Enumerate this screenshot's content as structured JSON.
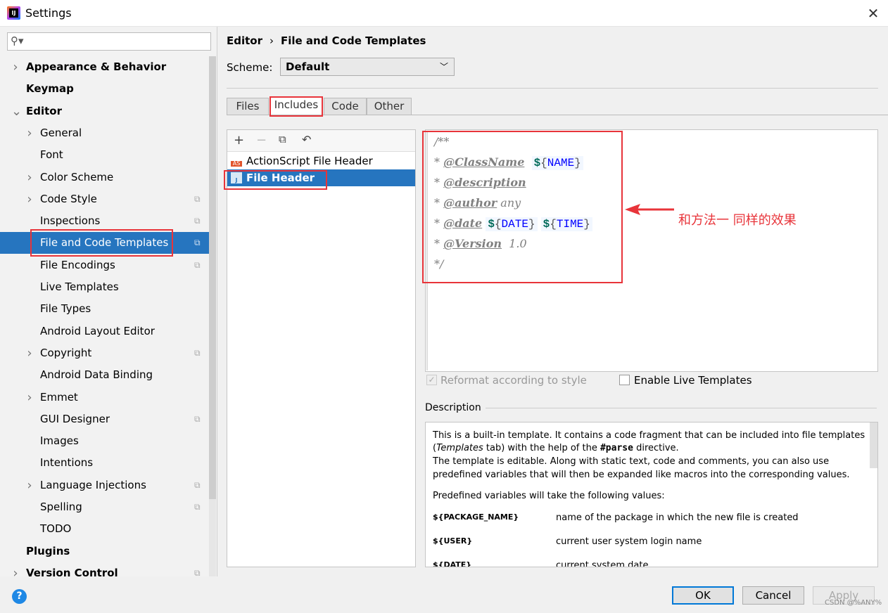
{
  "window": {
    "title": "Settings",
    "app_icon": "intellij-idea-icon"
  },
  "search": {
    "placeholder": ""
  },
  "sidebar": {
    "items": [
      {
        "label": "Appearance & Behavior",
        "level": 0,
        "expandable": true,
        "bold": true
      },
      {
        "label": "Keymap",
        "level": 0,
        "bold": true
      },
      {
        "label": "Editor",
        "level": 0,
        "expandable": true,
        "expanded": true,
        "bold": true
      },
      {
        "label": "General",
        "level": 1,
        "expandable": true
      },
      {
        "label": "Font",
        "level": 1
      },
      {
        "label": "Color Scheme",
        "level": 1,
        "expandable": true
      },
      {
        "label": "Code Style",
        "level": 1,
        "expandable": true,
        "copy": true
      },
      {
        "label": "Inspections",
        "level": 1,
        "copy": true
      },
      {
        "label": "File and Code Templates",
        "level": 1,
        "copy": true,
        "selected": true
      },
      {
        "label": "File Encodings",
        "level": 1,
        "copy": true
      },
      {
        "label": "Live Templates",
        "level": 1
      },
      {
        "label": "File Types",
        "level": 1
      },
      {
        "label": "Android Layout Editor",
        "level": 1
      },
      {
        "label": "Copyright",
        "level": 1,
        "expandable": true,
        "copy": true
      },
      {
        "label": "Android Data Binding",
        "level": 1
      },
      {
        "label": "Emmet",
        "level": 1,
        "expandable": true
      },
      {
        "label": "GUI Designer",
        "level": 1,
        "copy": true
      },
      {
        "label": "Images",
        "level": 1
      },
      {
        "label": "Intentions",
        "level": 1
      },
      {
        "label": "Language Injections",
        "level": 1,
        "expandable": true,
        "copy": true
      },
      {
        "label": "Spelling",
        "level": 1,
        "copy": true
      },
      {
        "label": "TODO",
        "level": 1
      },
      {
        "label": "Plugins",
        "level": 0,
        "bold": true
      },
      {
        "label": "Version Control",
        "level": 0,
        "expandable": true,
        "bold": true,
        "copy": true
      }
    ]
  },
  "breadcrumb": {
    "part1": "Editor",
    "separator": "›",
    "part2": "File and Code Templates"
  },
  "scheme": {
    "label": "Scheme:",
    "value": "Default"
  },
  "tabs": [
    {
      "label": "Files"
    },
    {
      "label": "Includes",
      "active": true
    },
    {
      "label": "Code"
    },
    {
      "label": "Other"
    }
  ],
  "template_list": [
    {
      "label": "ActionScript File Header",
      "icon": "AS"
    },
    {
      "label": "File Header",
      "icon": "J",
      "selected": true
    }
  ],
  "editor": {
    "lines": [
      {
        "star": "/**"
      },
      {
        "star": "* ",
        "tag": "@ClassName",
        "rest": "  ",
        "vars": [
          "NAME"
        ]
      },
      {
        "star": "* ",
        "tag": "@description"
      },
      {
        "star": "* ",
        "tag": "@author",
        "rest": " any"
      },
      {
        "star": "* ",
        "tag": "@date",
        "rest": " ",
        "vars": [
          "DATE",
          "TIME"
        ]
      },
      {
        "star": "* ",
        "tag": "@Version",
        "rest": "  1.0"
      },
      {
        "star": "*/"
      }
    ]
  },
  "annotation": "和方法一 同样的效果",
  "options": {
    "reformat": "Reformat according to style",
    "reformat_checked": true,
    "live": "Enable Live Templates",
    "live_checked": false
  },
  "description": {
    "label": "Description",
    "p1a": "This is a built-in template. It contains a code fragment that can be included into file templates (",
    "p1i": "Templates",
    "p1b": " tab) with the help of the ",
    "p1c": "#parse",
    "p1d": " directive.",
    "p2": "The template is editable. Along with static text, code and comments, you can also use predefined variables that will then be expanded like macros into the corresponding values.",
    "p3": "Predefined variables will take the following values:",
    "vars": [
      {
        "name": "${PACKAGE_NAME}",
        "desc": "name of the package in which the new file is created"
      },
      {
        "name": "${USER}",
        "desc": "current user system login name"
      },
      {
        "name": "${DATE}",
        "desc": "current system date"
      }
    ]
  },
  "buttons": {
    "ok": "OK",
    "cancel": "Cancel",
    "apply": "Apply"
  },
  "watermark": "CSDN @%ANY%",
  "colors": {
    "selection": "#2675bf",
    "highlight": "#e8343a"
  }
}
